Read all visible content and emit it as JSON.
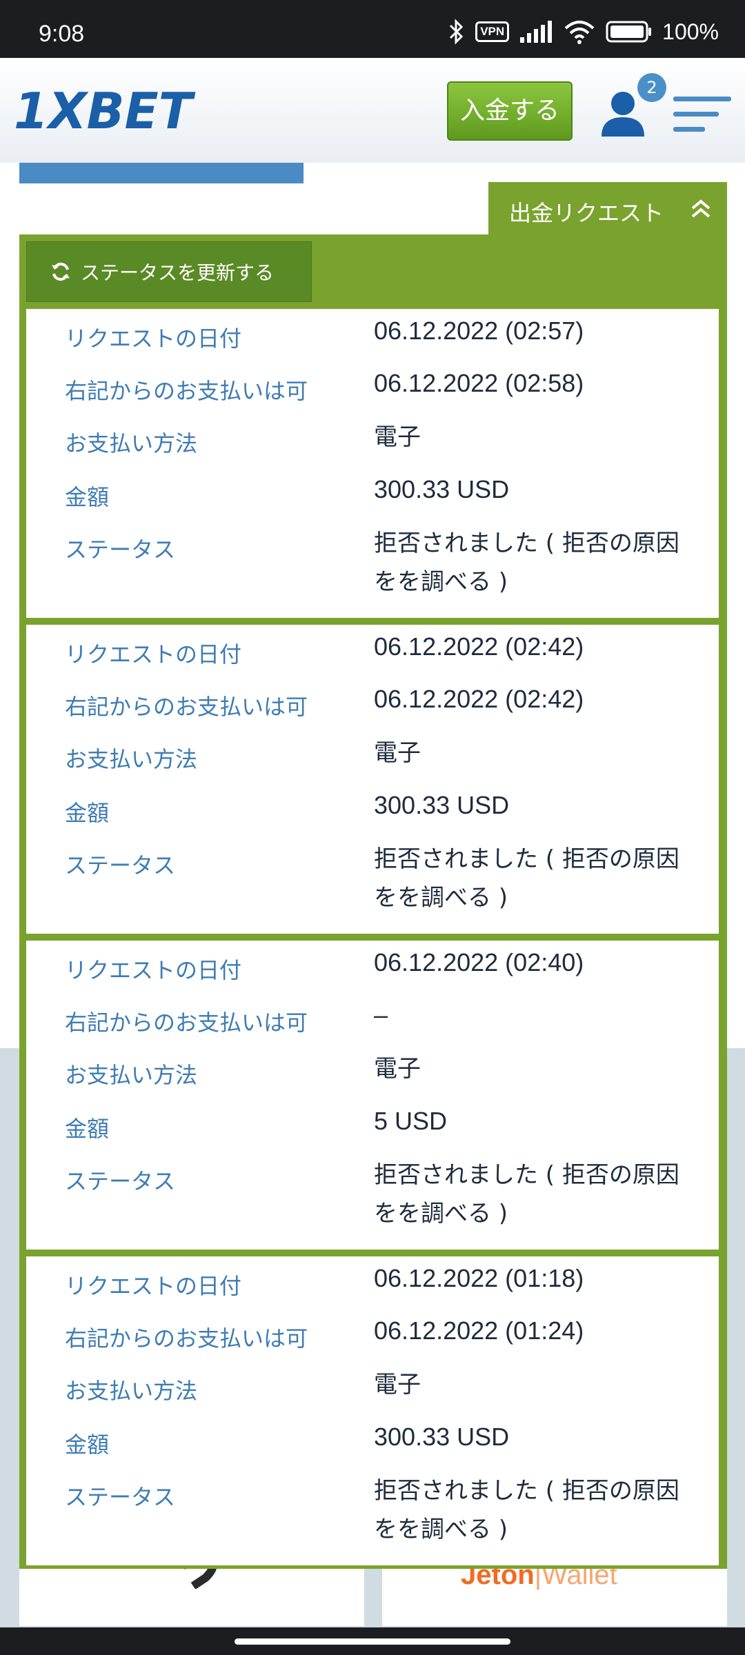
{
  "status_bar": {
    "time": "9:08",
    "vpn": "VPN",
    "battery": "100%"
  },
  "header": {
    "brand": "1XBET",
    "deposit_label": "入金する",
    "notification_count": "2"
  },
  "panel": {
    "tab_label": "出金リクエスト",
    "refresh_label": "ステータスを更新する",
    "labels": {
      "request_date": "リクエストの日付",
      "payable_from": "右記からのお支払いは可",
      "payment_method": "お支払い方法",
      "amount": "金額",
      "status": "ステータス"
    },
    "requests": [
      {
        "request_date": "06.12.2022 (02:57)",
        "payable_from": "06.12.2022 (02:58)",
        "payment_method": "電子",
        "amount": "300.33 USD",
        "status": "拒否されました ( 拒否の原因をを調べる )"
      },
      {
        "request_date": "06.12.2022 (02:42)",
        "payable_from": "06.12.2022 (02:42)",
        "payment_method": "電子",
        "amount": "300.33 USD",
        "status": "拒否されました ( 拒否の原因をを調べる )"
      },
      {
        "request_date": "06.12.2022 (02:40)",
        "payable_from": "–",
        "payment_method": "電子",
        "amount": "5 USD",
        "status": "拒否されました ( 拒否の原因をを調べる )"
      },
      {
        "request_date": "06.12.2022 (01:18)",
        "payable_from": "06.12.2022 (01:24)",
        "payment_method": "電子",
        "amount": "300.33 USD",
        "status": "拒否されました ( 拒否の原因をを調べる )"
      }
    ]
  },
  "partners": {
    "jeton_brand": "Jeton",
    "jeton_suffix": "|Wallet"
  },
  "colors": {
    "panel_green": "#7aa22e",
    "label_blue": "#3e7cb4",
    "deposit_green": "#6fae2a",
    "brand_blue": "#1a5fa8"
  }
}
